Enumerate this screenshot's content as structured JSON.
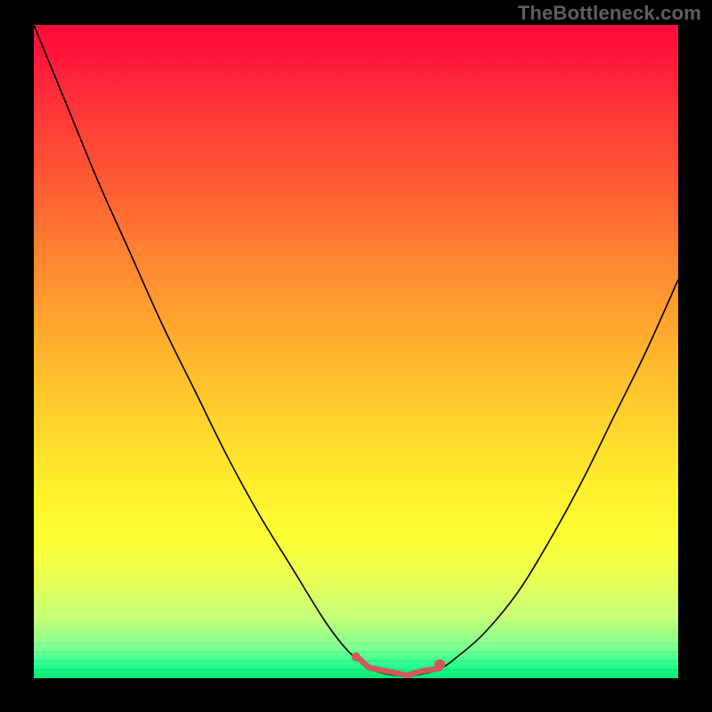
{
  "watermark": "TheBottleneck.com",
  "colors": {
    "frame_bg": "#000000",
    "curve_stroke": "#000000",
    "marker_stroke": "#cf5a57",
    "watermark_text": "#5f5f5f"
  },
  "chart_data": {
    "type": "line",
    "title": "",
    "xlabel": "",
    "ylabel": "",
    "xlim": [
      0,
      100
    ],
    "ylim": [
      0,
      100
    ],
    "x": [
      0,
      5,
      10,
      15,
      20,
      25,
      30,
      35,
      40,
      45,
      48,
      50,
      52,
      55,
      58,
      60,
      63,
      66,
      70,
      75,
      80,
      85,
      90,
      95,
      100
    ],
    "series": [
      {
        "name": "bottleneck-curve",
        "values": [
          100,
          88,
          76,
          65,
          54,
          44,
          34,
          25,
          17,
          9,
          5,
          3,
          1.5,
          0.6,
          0.3,
          0.6,
          1.4,
          3.5,
          7,
          13,
          21,
          30,
          40,
          50,
          61
        ]
      }
    ],
    "optimal_region": {
      "x_start": 50,
      "x_end": 63,
      "note": "flat minimum segment highlighted in red"
    },
    "background_gradient": {
      "orientation": "vertical",
      "stops": [
        {
          "pos": 0.0,
          "color": "#ff0a3a"
        },
        {
          "pos": 0.24,
          "color": "#ff5a33"
        },
        {
          "pos": 0.48,
          "color": "#ffad2e"
        },
        {
          "pos": 0.71,
          "color": "#fff02b"
        },
        {
          "pos": 0.9,
          "color": "#c6ff78"
        },
        {
          "pos": 1.0,
          "color": "#00e877"
        }
      ]
    }
  }
}
